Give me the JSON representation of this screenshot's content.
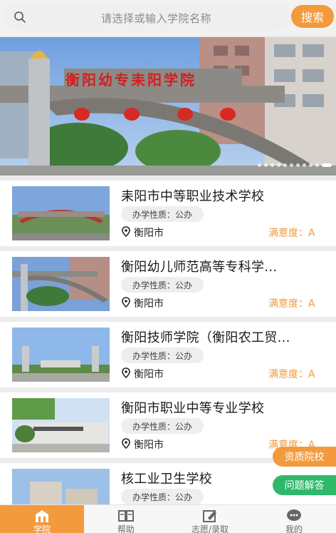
{
  "search": {
    "placeholder": "请选择或输入学院名称",
    "button_label": "搜索"
  },
  "banner": {
    "sign_text": "衡阳幼专耒阳学院",
    "slide_count": 11,
    "active_slide": 11
  },
  "schools": [
    {
      "name": "耒阳市中等职业技术学校",
      "nature": "办学性质：公办",
      "city": "衡阳市",
      "satisfaction": "满意度：A"
    },
    {
      "name": "衡阳幼儿师范高等专科学...",
      "nature": "办学性质：公办",
      "city": "衡阳市",
      "satisfaction": "满意度：A"
    },
    {
      "name": "衡阳技师学院（衡阳农工贸...",
      "nature": "办学性质：公办",
      "city": "衡阳市",
      "satisfaction": "满意度：A"
    },
    {
      "name": "衡阳市职业中等专业学校",
      "nature": "办学性质：公办",
      "city": "衡阳市",
      "satisfaction": "满意度：A"
    },
    {
      "name": "核工业卫生学校",
      "nature": "办学性质：公办",
      "city": "",
      "satisfaction": ""
    }
  ],
  "floating": {
    "qualified_label": "资质院校",
    "faq_label": "问题解答"
  },
  "tabs": [
    {
      "label": "学院",
      "icon": "school-icon",
      "active": true
    },
    {
      "label": "帮助",
      "icon": "book-icon",
      "active": false
    },
    {
      "label": "志愿/录取",
      "icon": "edit-icon",
      "active": false
    },
    {
      "label": "我的",
      "icon": "chat-icon",
      "active": false
    }
  ],
  "colors": {
    "accent": "#f39a3c",
    "green": "#2fb86a"
  }
}
